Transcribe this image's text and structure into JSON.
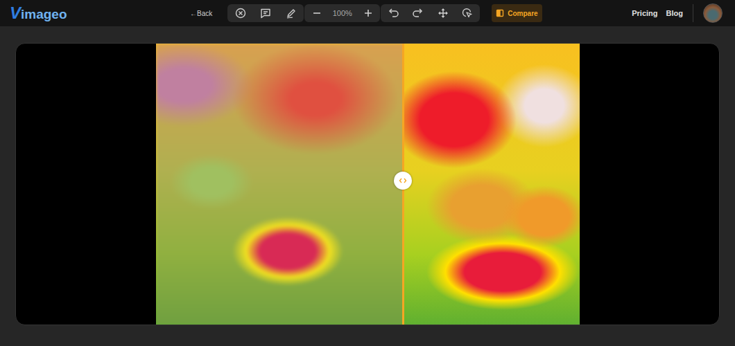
{
  "logo": {
    "mark": "V",
    "text": "imageo"
  },
  "toolbar": {
    "back": {
      "icon": "←",
      "label": "Back"
    },
    "zoom": "100%"
  },
  "compare": {
    "label": "Compare",
    "active": true
  },
  "nav": [
    "Pricing",
    "Blog"
  ],
  "slider": {
    "level": 0.583
  }
}
